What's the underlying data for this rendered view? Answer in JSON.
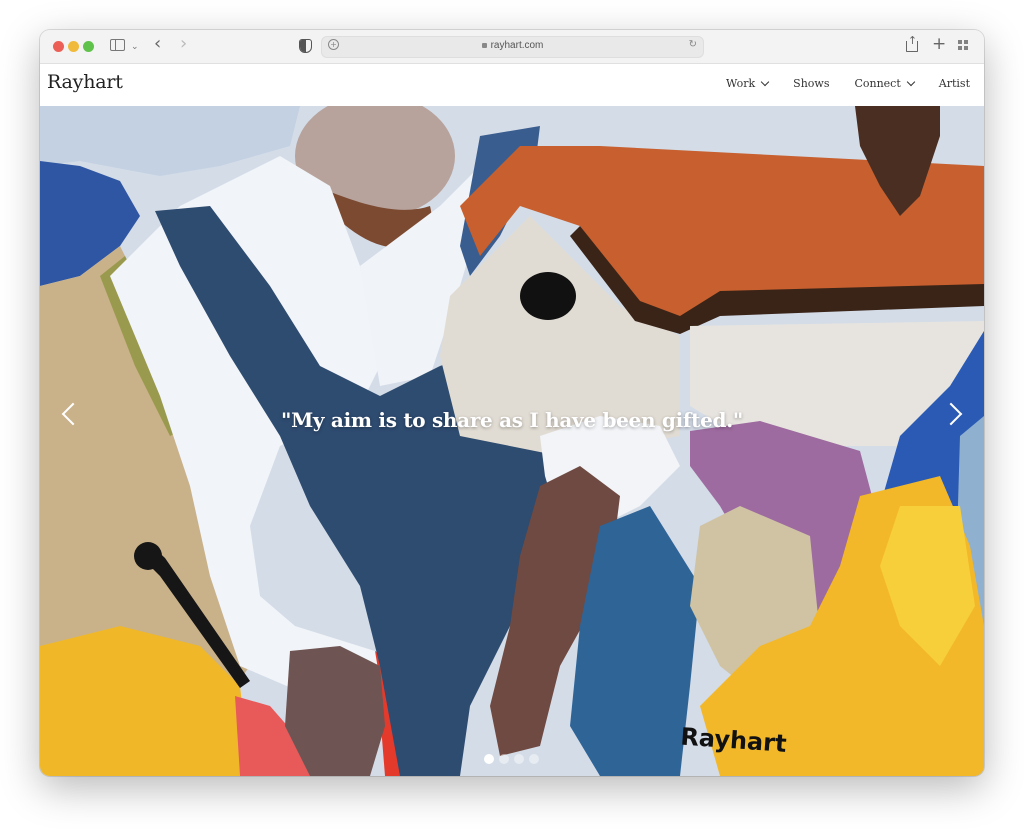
{
  "browser": {
    "url": "rayhart.com",
    "icons": [
      "sidebar-icon",
      "chevron-down-icon",
      "back-icon",
      "forward-icon",
      "privacy-shield-icon",
      "lock-icon",
      "reload-icon",
      "share-icon",
      "new-tab-icon",
      "tab-overview-icon"
    ]
  },
  "site": {
    "brand": "Rayhart",
    "nav": [
      {
        "label": "Work",
        "has_dropdown": true
      },
      {
        "label": "Shows",
        "has_dropdown": false
      },
      {
        "label": "Connect",
        "has_dropdown": true
      },
      {
        "label": "Artist",
        "has_dropdown": false
      }
    ]
  },
  "hero": {
    "quote": "\"My aim is to share as I have been gifted.\"",
    "signature": "Rayhart",
    "slide_count": 4,
    "active_slide": 1,
    "colors": {
      "sky": "#d6dde8",
      "roof": "#c9622c",
      "navy": "#2c4a6e",
      "white": "#f3f5f8",
      "yellow": "#f2b92c",
      "purple": "#9b6a9e",
      "brown": "#6b4a40",
      "red": "#e53b32"
    }
  }
}
